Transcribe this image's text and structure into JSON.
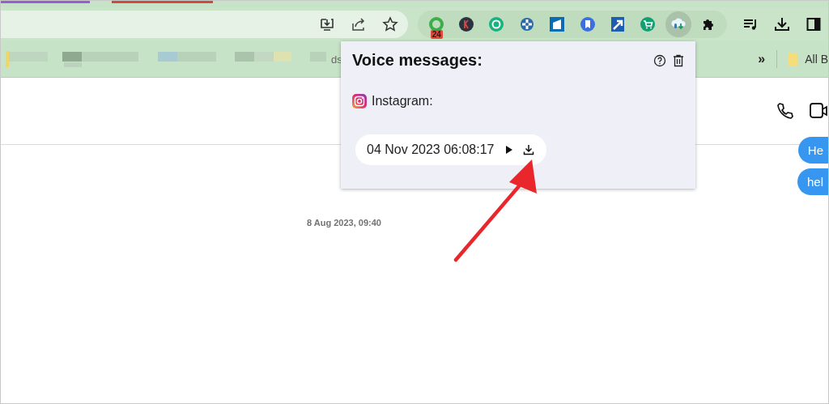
{
  "extensions": [
    {
      "selected": false,
      "badge": "24"
    },
    {
      "selected": false
    },
    {
      "selected": false
    },
    {
      "selected": false
    },
    {
      "selected": false
    },
    {
      "selected": false
    },
    {
      "selected": false
    },
    {
      "selected": false
    },
    {
      "selected": true
    },
    {
      "selected": false
    }
  ],
  "bookmarks_bar": {
    "partial_text": "ds",
    "overflow": "»",
    "folder": "All B"
  },
  "popup": {
    "title": "Voice messages:",
    "source": "Instagram:",
    "messages": [
      {
        "timestamp": "04 Nov 2023 06:08:17"
      }
    ]
  },
  "chat": {
    "bubbles": [
      "He",
      "hel"
    ],
    "date": "8 Aug 2023, 09:40"
  }
}
